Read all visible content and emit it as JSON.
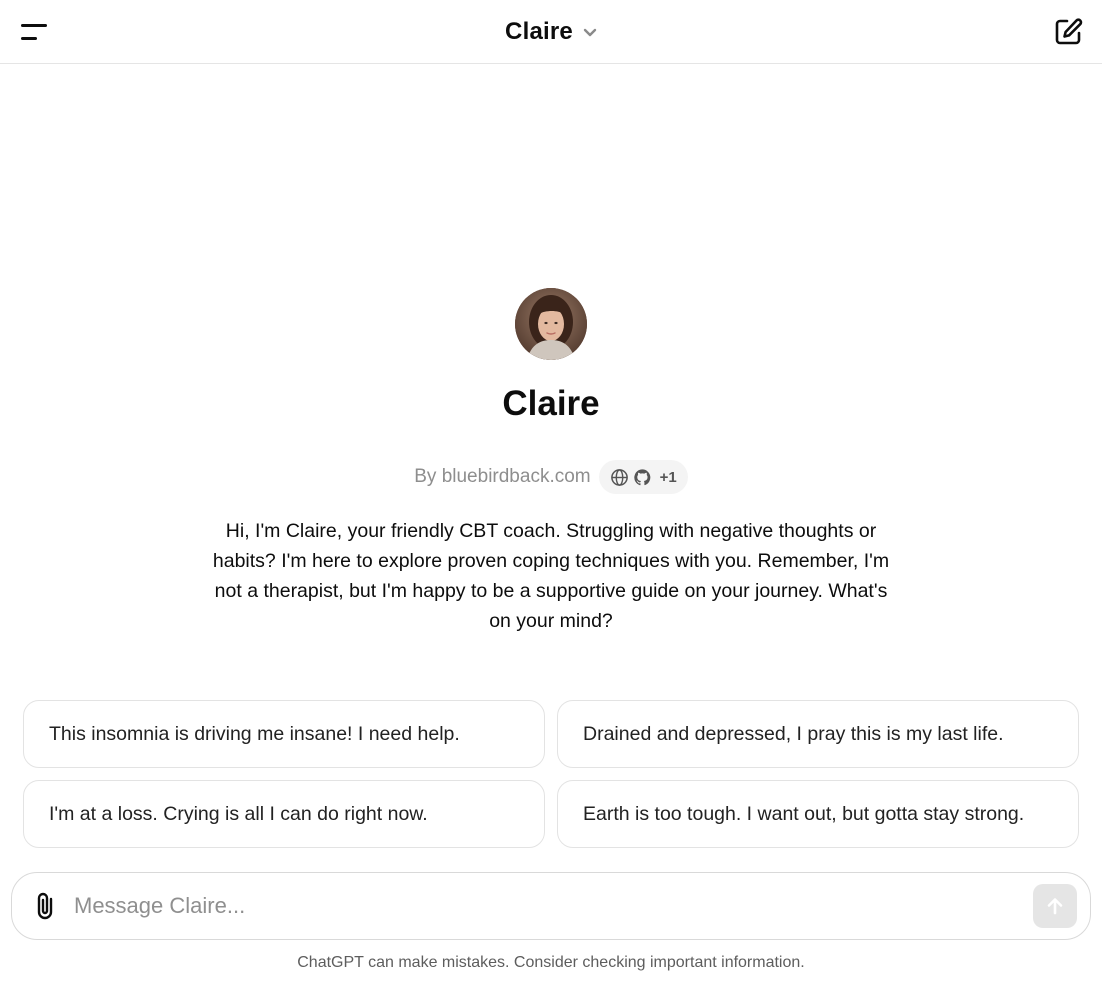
{
  "header": {
    "title": "Claire",
    "menu_icon": "sidebar-toggle-icon",
    "new_chat_icon": "new-chat-icon"
  },
  "gpt": {
    "name": "Claire",
    "author": "By bluebirdback.com",
    "capabilities": [
      "globe-icon",
      "github-icon"
    ],
    "capabilities_more": "+1",
    "description": "Hi, I'm Claire, your friendly CBT coach. Struggling with negative thoughts or habits? I'm here to explore proven coping techniques with you. Remember, I'm not a therapist, but I'm happy to be a supportive guide on your journey. What's on your mind?"
  },
  "starters": [
    {
      "label": "This insomnia is driving me insane! I need help."
    },
    {
      "label": "Drained and depressed, I pray this is my last life."
    },
    {
      "label": "I'm at a loss. Crying is all I can do right now."
    },
    {
      "label": "Earth is too tough. I want out, but gotta stay strong."
    }
  ],
  "composer": {
    "placeholder": "Message Claire...",
    "value": ""
  },
  "footer": {
    "note": "ChatGPT can make mistakes. Consider checking important information."
  },
  "colors": {
    "send_button_disabled": "#e5e5e5",
    "border": "#e3e3e3",
    "muted_text": "#8e8e8e"
  }
}
